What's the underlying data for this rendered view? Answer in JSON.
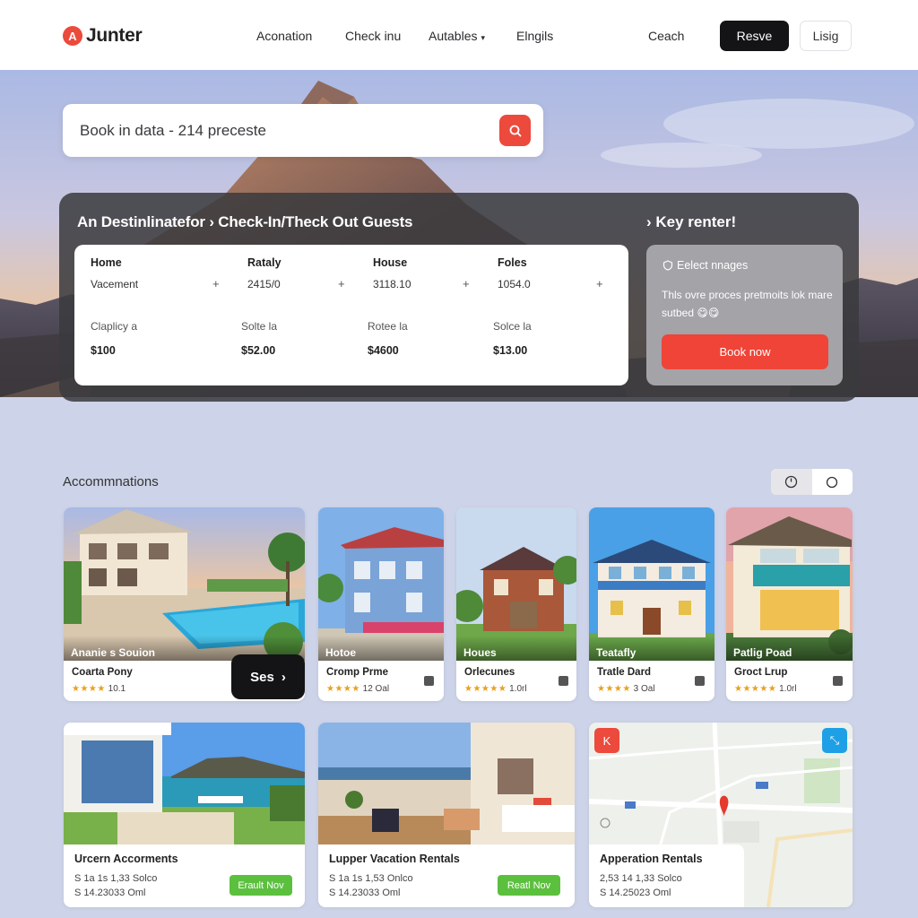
{
  "brand": {
    "logo_letter": "A",
    "name": "Junter",
    "accent": "#ec4a3c"
  },
  "nav": {
    "links": [
      "Aconation",
      "Check inu",
      "Autables",
      "Elngils",
      "Ceach"
    ],
    "reserve_label": "Resve",
    "login_label": "Lisig"
  },
  "search": {
    "text": "Book in data - 214 preceste",
    "icon": "search-icon"
  },
  "panel": {
    "title": "An Destinlinatefor  ›  Check-In/Theck Out Guests",
    "side_title": "› Key renter!",
    "columns": [
      {
        "head": "Home",
        "sub": "Vacement",
        "label": "Claplicy a",
        "price": "$100"
      },
      {
        "head": "Rataly",
        "sub": "2415/0",
        "label": "Solte la",
        "price": "$52.00"
      },
      {
        "head": "House",
        "sub": "3118.10",
        "label": "Rotee la",
        "price": "$4600"
      },
      {
        "head": "Foles",
        "sub": "1054.0",
        "label": "Solce la",
        "price": "$13.00"
      }
    ],
    "plus": "+",
    "side": {
      "select_label": "Eelect nnages",
      "description": "Thls ovre proces pretmoits lok mare sutbed 😋😋",
      "book_label": "Book now"
    }
  },
  "accommodations": {
    "title": "Accommnations",
    "cards": [
      {
        "overlay": "Ananie s Souion",
        "title": "Coarta Pony",
        "stars": "★★★★",
        "rating": "10.1"
      },
      {
        "overlay": "Hotoe",
        "title": "Cromp Prme",
        "stars": "★★★★",
        "rating": "12 Oal"
      },
      {
        "overlay": "Houes",
        "title": "Orlecunes",
        "stars": "★★★★★",
        "rating": "1.0rl"
      },
      {
        "overlay": "Teatafly",
        "title": "Tratle Dard",
        "stars": "★★★★",
        "rating": "3 Oal"
      },
      {
        "overlay": "Patlig Poad",
        "title": "Groct Lrup",
        "stars": "★★★★★",
        "rating": "1.0rl"
      }
    ],
    "see_label": "Ses",
    "big_cards": [
      {
        "title": "Urcern Accorments",
        "meta1": "S 1a 1s 1,33 Solco",
        "meta2": "S 14.23033 Oml",
        "button": "Erault Nov"
      },
      {
        "title": "Lupper Vacation Rentals",
        "meta1": "S 1a 1s 1,53 Onlco",
        "meta2": "S 14.23033 Oml",
        "button": "Reatl Nov"
      },
      {
        "title": "Apperation Rentals",
        "meta1": "2,53 14 1,33 Solco",
        "meta2": "S 14.25023 Oml"
      }
    ]
  }
}
